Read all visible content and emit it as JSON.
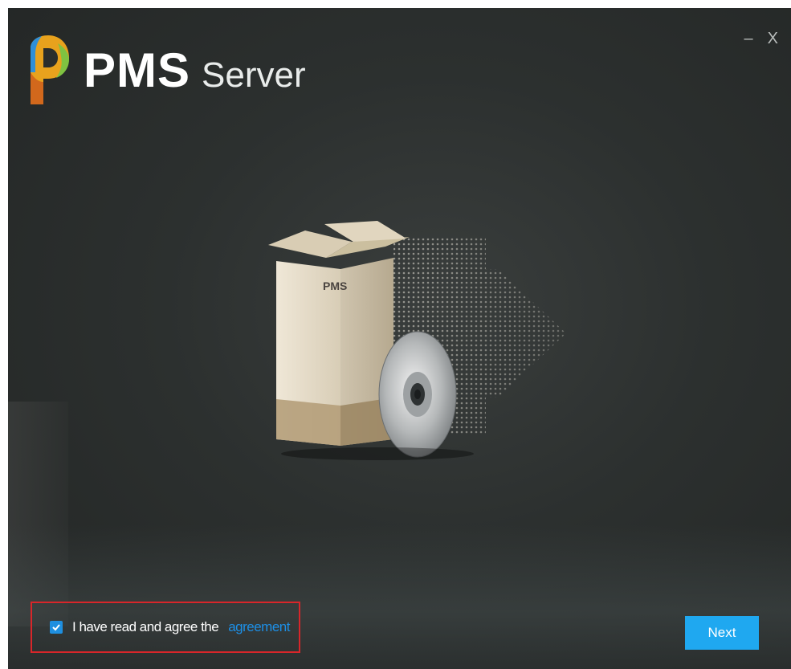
{
  "window": {
    "brand_name": "PMS",
    "brand_sub": "Server",
    "minimize_glyph": "–",
    "close_glyph": "X"
  },
  "hero": {
    "box_label": "PMS",
    "icons": [
      "product-box-icon",
      "cd-disc-icon",
      "dotted-arrow-icon"
    ]
  },
  "footer": {
    "agree_checked": true,
    "agree_text": "I have read and agree the",
    "agreement_link": "agreement",
    "next_label": "Next"
  },
  "colors": {
    "accent": "#1fa8f0",
    "link": "#1d8fe6",
    "highlight_border": "#d8262a",
    "background": "#2c302f"
  }
}
